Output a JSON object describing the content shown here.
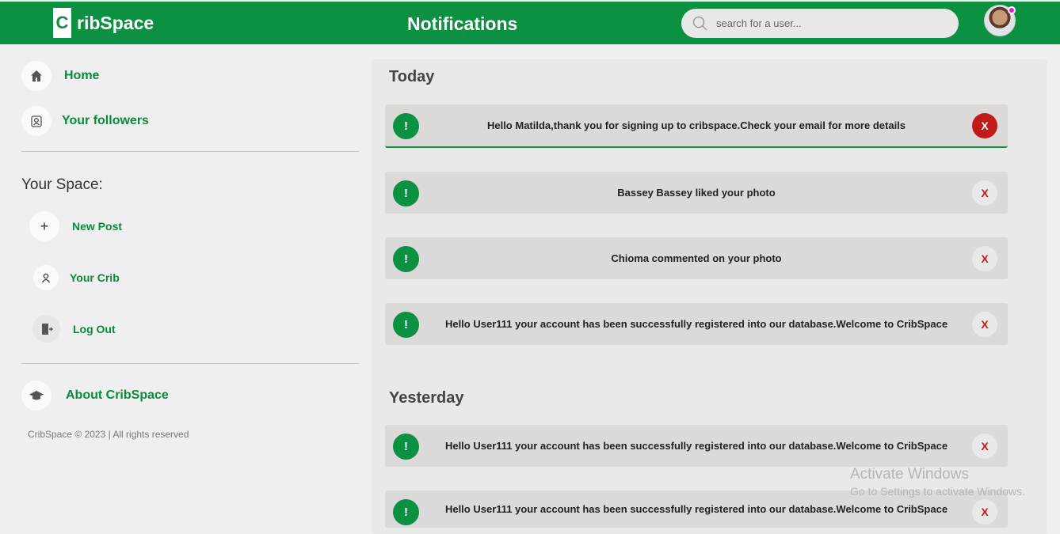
{
  "header": {
    "logo_letter": "C",
    "logo_text": "ribSpace",
    "title": "Notifications",
    "search_placeholder": "search for a user..."
  },
  "sidebar": {
    "home": "Home",
    "followers": "Your followers",
    "space_title": "Your Space:",
    "new_post": "New Post",
    "your_crib": "Your Crib",
    "log_out": "Log Out",
    "about": "About CribSpace",
    "footer": "CribSpace © 2023 | All rights reserved"
  },
  "notifications": {
    "today_title": "Today",
    "yesterday_title": "Yesterday",
    "bang": "!",
    "close": "X",
    "today": [
      "Hello Matilda,thank you for signing up to cribspace.Check your email for more details",
      "Bassey Bassey liked your photo",
      "Chioma commented on your photo",
      "Hello User111 your account has been successfully registered into our database.Welcome to CribSpace"
    ],
    "yesterday": [
      "Hello User111 your account has been successfully registered into our database.Welcome to CribSpace",
      "Hello User111 your account has been successfully registered into our database.Welcome to CribSpace"
    ]
  },
  "watermark": {
    "line1": "Activate Windows",
    "line2": "Go to Settings to activate Windows."
  },
  "colors": {
    "brand": "#0b9141",
    "danger": "#c01a1a"
  }
}
